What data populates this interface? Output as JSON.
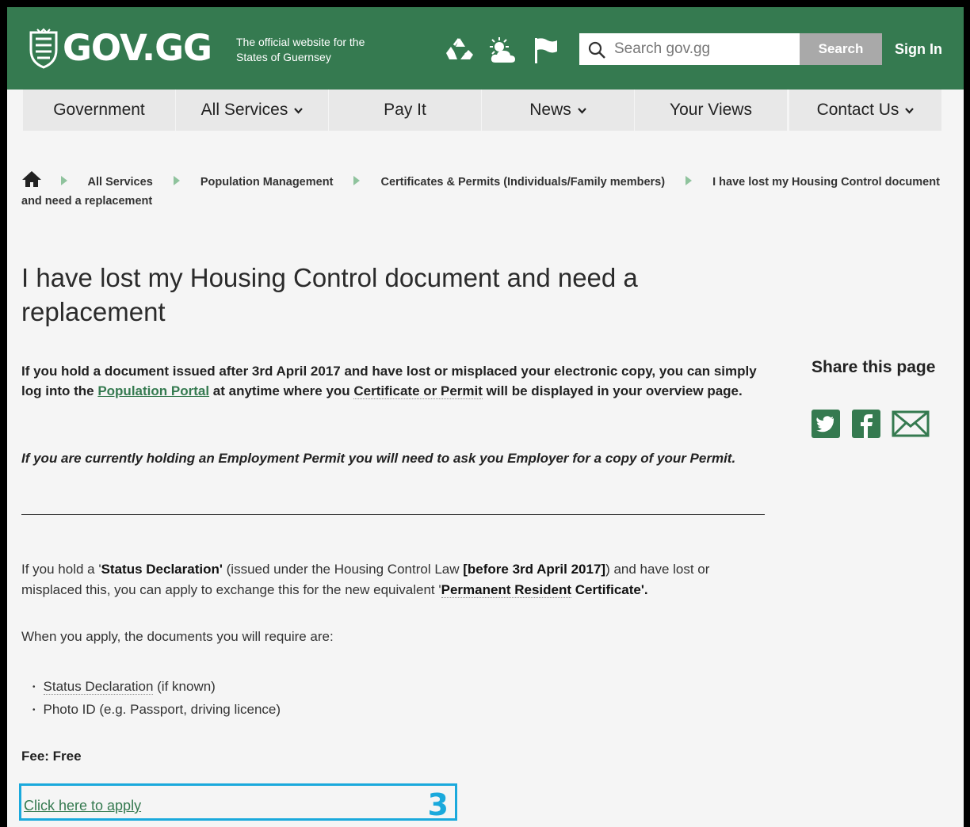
{
  "header": {
    "logo_text": "GOV.GG",
    "tagline_line1": "The official website for the",
    "tagline_line2": "States of Guernsey",
    "icons": [
      "recycle-icon",
      "weather-icon",
      "flag-icon"
    ],
    "search": {
      "placeholder": "Search gov.gg",
      "button_label": "Search"
    },
    "signin_label": "Sign In",
    "brand_color": "#357a50"
  },
  "nav": {
    "items": [
      {
        "label": "Government",
        "has_dropdown": false
      },
      {
        "label": "All Services",
        "has_dropdown": true
      },
      {
        "label": "Pay It",
        "has_dropdown": false
      },
      {
        "label": "News",
        "has_dropdown": true
      },
      {
        "label": "Your Views",
        "has_dropdown": false
      },
      {
        "label": "Contact Us",
        "has_dropdown": true
      }
    ]
  },
  "breadcrumb": {
    "items": [
      "All Services",
      "Population Management",
      "Certificates & Permits (Individuals/Family members)"
    ],
    "current": "I have lost my Housing Control document and need a replacement"
  },
  "page": {
    "title": "I have lost my Housing Control document and need a replacement",
    "intro_part1": "If you hold a document issued after 3rd April 2017 and have lost or misplaced your electronic copy, you can simply log into the ",
    "intro_link": "Population Portal",
    "intro_part2": " at anytime where you ",
    "intro_dotted": "Certificate or Permit",
    "intro_part3": " will be displayed in your overview page.",
    "italic_note": "If you are currently holding an Employment Permit you will need to ask you Employer for a copy of your Permit.",
    "status_p1": "If you hold a '",
    "status_b1": "Status Declaration'",
    "status_p2": " (issued under the Housing Control Law ",
    "status_b2": "[before 3rd April 2017]",
    "status_p3": ") and have lost or misplaced this, you can apply to exchange this for the new equivalent '",
    "status_b3": "Permanent Resident",
    "status_b4": " Certificate'.",
    "docs_intro": "When you apply, the documents you will require are:",
    "docs": [
      {
        "dotted": "Status Declaration",
        "rest": " (if known)"
      },
      {
        "dotted": "",
        "rest": "Photo ID (e.g. Passport, driving licence)"
      }
    ],
    "fee": "Fee: Free",
    "apply_link": "Click here to apply",
    "annotation_number": "3",
    "annotation_color": "#1aa9dc"
  },
  "share": {
    "title": "Share this page",
    "icons": [
      "twitter-icon",
      "facebook-icon",
      "email-icon"
    ]
  }
}
